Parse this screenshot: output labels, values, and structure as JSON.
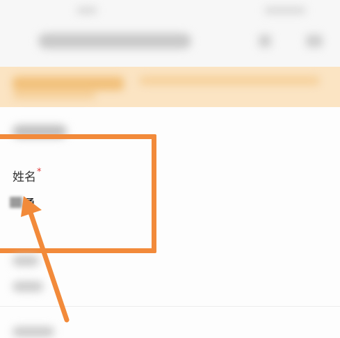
{
  "form": {
    "name_field": {
      "label": "姓名",
      "required_marker": "*",
      "value_visible": "勇"
    }
  },
  "annotation": {
    "highlight_color": "#f28a3a",
    "arrow_color": "#f28a3a",
    "arrow_icon": "annotation-arrow-icon"
  },
  "colors": {
    "notice_background": "#fbe4c3",
    "required_color": "#e03a3a"
  }
}
